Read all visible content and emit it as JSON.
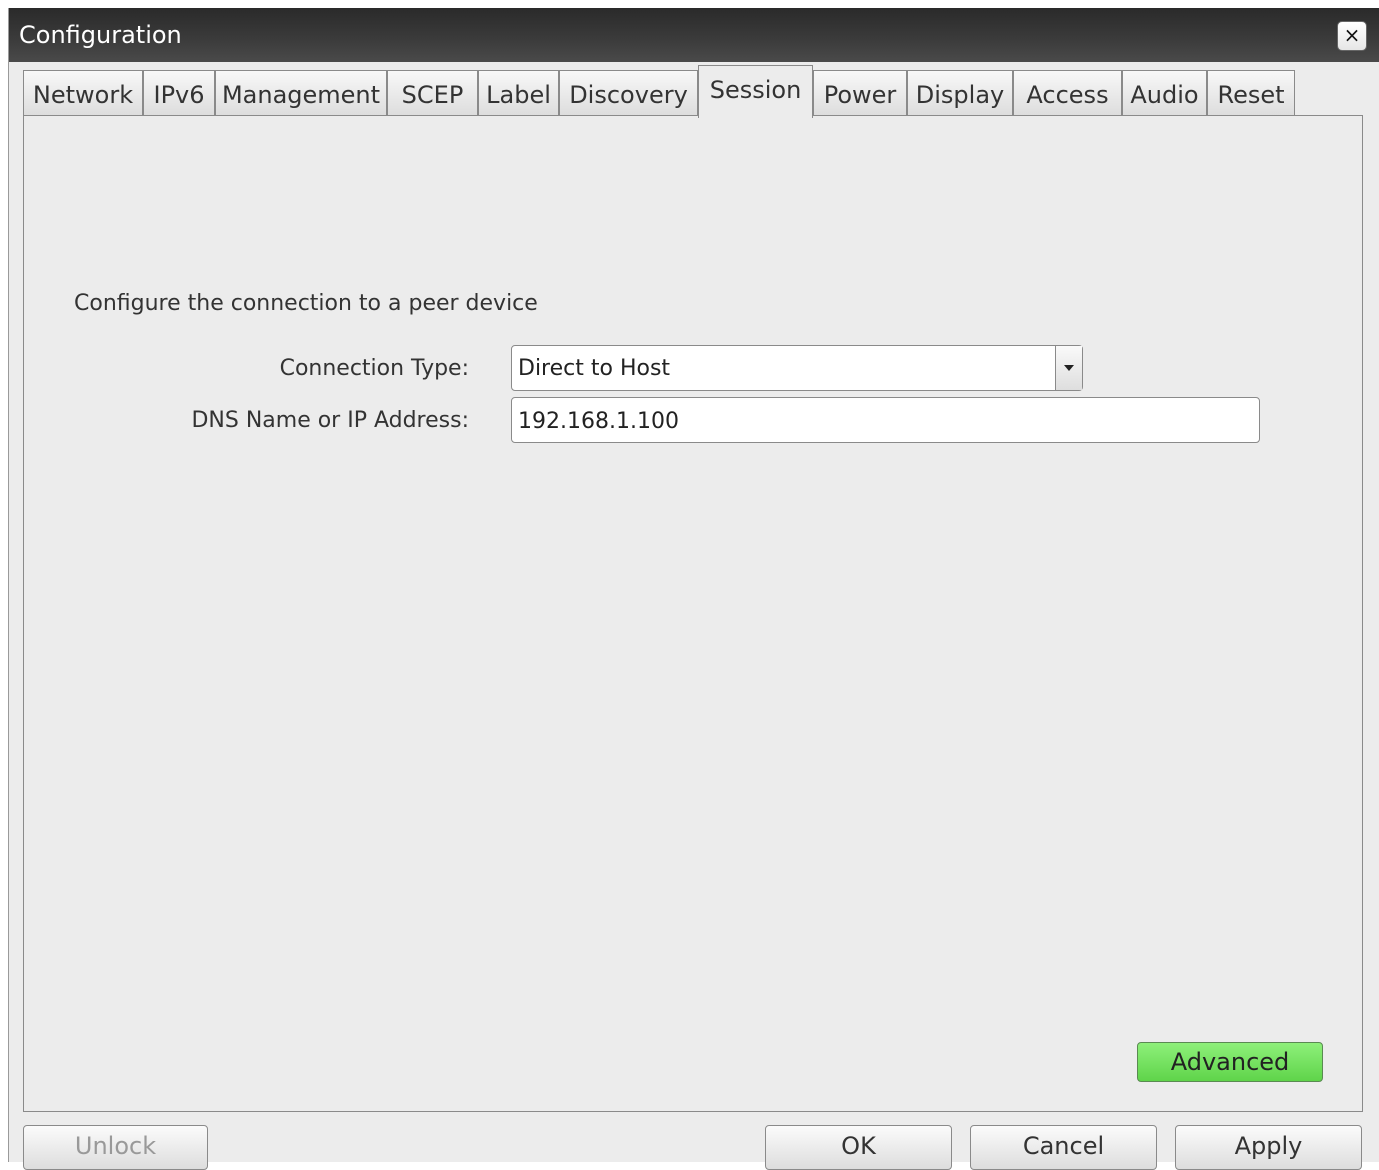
{
  "window": {
    "title": "Configuration",
    "close_label": "×"
  },
  "tabs": [
    {
      "label": "Network"
    },
    {
      "label": "IPv6"
    },
    {
      "label": "Management"
    },
    {
      "label": "SCEP"
    },
    {
      "label": "Label"
    },
    {
      "label": "Discovery"
    },
    {
      "label": "Session",
      "active": true
    },
    {
      "label": "Power"
    },
    {
      "label": "Display"
    },
    {
      "label": "Access"
    },
    {
      "label": "Audio"
    },
    {
      "label": "Reset"
    }
  ],
  "session": {
    "intro": "Configure the connection to a peer device",
    "connection_type_label": "Connection Type:",
    "connection_type_value": "Direct to Host",
    "dns_label": "DNS Name or IP Address:",
    "dns_value": "192.168.1.100",
    "advanced_label": "Advanced"
  },
  "footer": {
    "unlock_label": "Unlock",
    "ok_label": "OK",
    "cancel_label": "Cancel",
    "apply_label": "Apply"
  },
  "colors": {
    "titlebar": "#333333",
    "advanced_button": "#6ee05a"
  }
}
